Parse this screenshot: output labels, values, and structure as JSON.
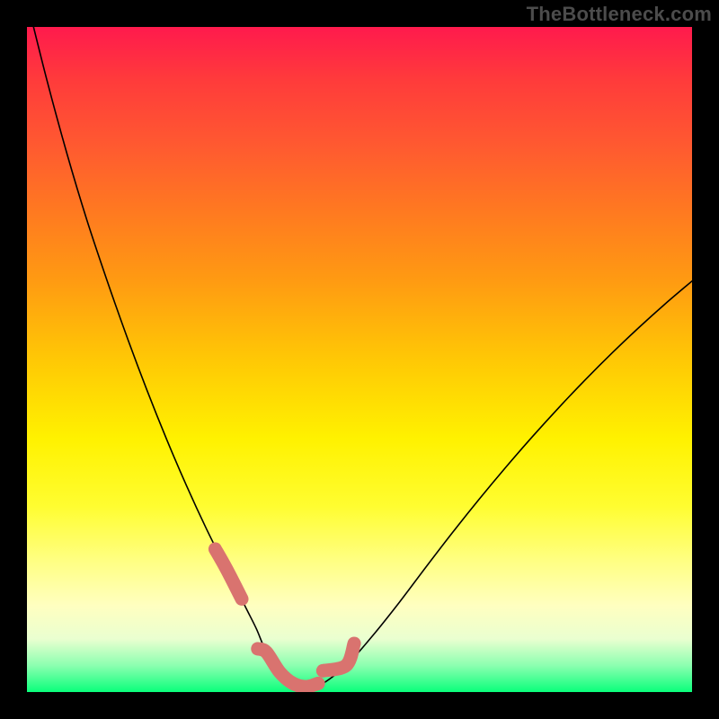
{
  "watermark": "TheBottleneck.com",
  "chart_data": {
    "type": "line",
    "title": "",
    "xlabel": "",
    "ylabel": "",
    "xlim": [
      0,
      100
    ],
    "ylim": [
      0,
      100
    ],
    "series": [
      {
        "name": "bottleneck-curve",
        "x": [
          0,
          3,
          6,
          9,
          12,
          15,
          18,
          21,
          24,
          27,
          30,
          33,
          34.5,
          36,
          38,
          40,
          42,
          44,
          48,
          52,
          56,
          60,
          64,
          68,
          72,
          76,
          80,
          84,
          88,
          92,
          96,
          100
        ],
        "y": [
          104,
          92,
          81,
          71,
          62,
          53.5,
          45.5,
          38,
          31,
          24.5,
          18.5,
          12.5,
          9.5,
          6,
          3,
          1.3,
          0.8,
          1.0,
          4,
          8.5,
          13.5,
          18.8,
          24,
          29,
          33.8,
          38.4,
          42.8,
          47,
          51,
          54.8,
          58.4,
          61.8
        ]
      }
    ],
    "highlight_segments": [
      {
        "name": "left-slope-marker",
        "x": [
          28.3,
          32.3
        ],
        "y": [
          21.5,
          14
        ]
      },
      {
        "name": "flat-bottom-marker",
        "x": [
          34.7,
          43.8
        ],
        "y": [
          6.5,
          1.3
        ]
      },
      {
        "name": "right-slope-marker",
        "x": [
          44.5,
          49.2
        ],
        "y": [
          3.2,
          7.3
        ]
      }
    ],
    "gradient_stops": [
      {
        "pos": 0,
        "color": "#ff1a4d"
      },
      {
        "pos": 50,
        "color": "#ffc805"
      },
      {
        "pos": 80,
        "color": "#ffff80"
      },
      {
        "pos": 100,
        "color": "#0aff7b"
      }
    ]
  }
}
